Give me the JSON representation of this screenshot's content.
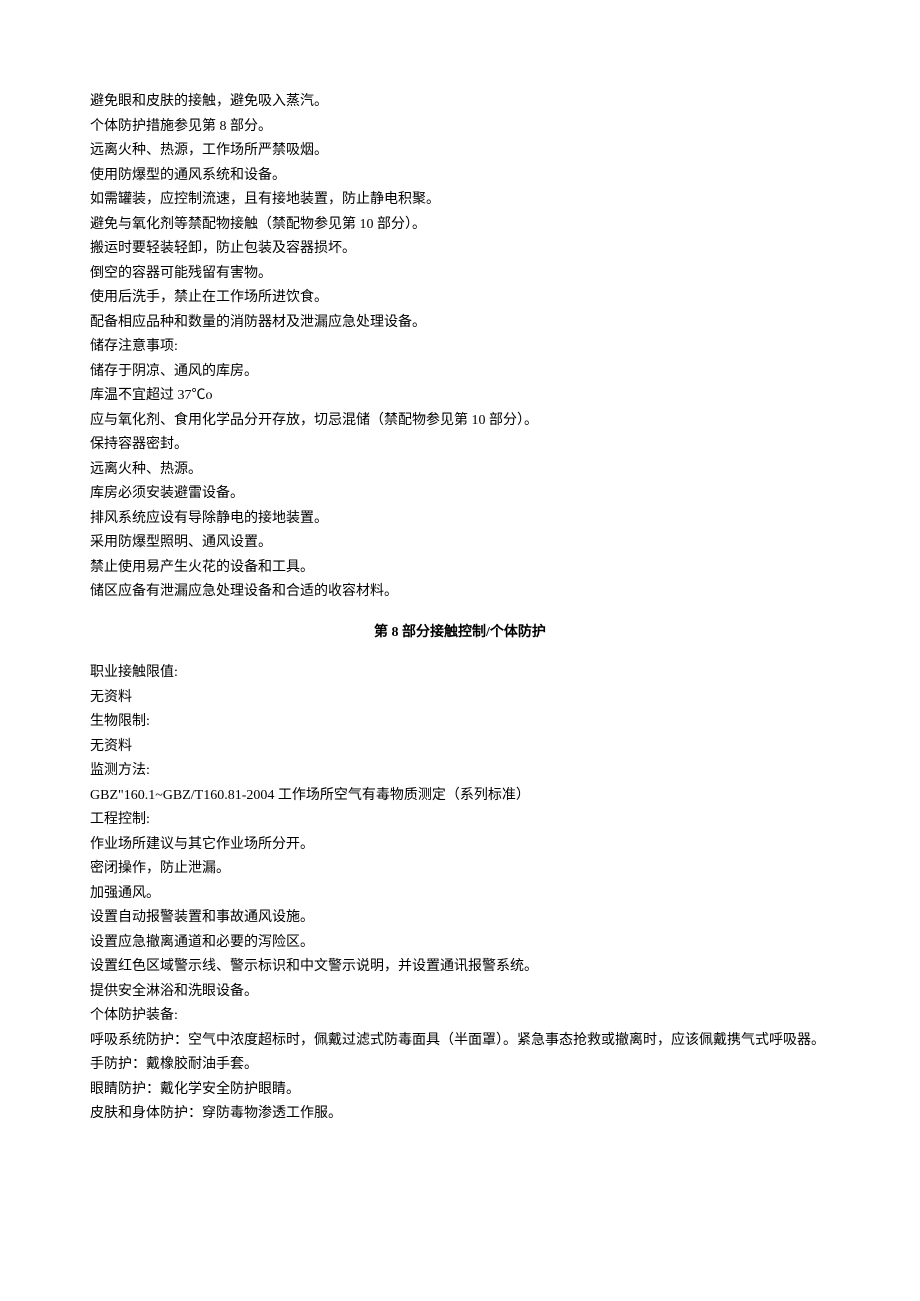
{
  "section7": {
    "handling_lines": [
      "避免眼和皮肤的接触，避免吸入蒸汽。",
      "个体防护措施参见第 8 部分。",
      "远离火种、热源，工作场所严禁吸烟。",
      "使用防爆型的通风系统和设备。",
      "如需罐装，应控制流速，且有接地装置，防止静电积聚。",
      "避免与氧化剂等禁配物接触（禁配物参见第 10 部分）。",
      "搬运时要轻装轻卸，防止包装及容器损坏。",
      "倒空的容器可能残留有害物。",
      "使用后洗手，禁止在工作场所进饮食。",
      "配备相应品种和数量的消防器材及泄漏应急处理设备。"
    ],
    "storage_heading": "储存注意事项:",
    "storage_lines": [
      "储存于阴凉、通风的库房。",
      "库温不宜超过 37℃o",
      "应与氧化剂、食用化学品分开存放，切忌混储（禁配物参见第 10 部分）。",
      "保持容器密封。",
      "远离火种、热源。",
      "库房必须安装避雷设备。",
      "排风系统应设有导除静电的接地装置。",
      "采用防爆型照明、通风设置。",
      "禁止使用易产生火花的设备和工具。",
      "储区应备有泄漏应急处理设备和合适的收容材料。"
    ]
  },
  "section8": {
    "title_prefix": "第 ",
    "title_num": "8",
    "title_suffix": " 部分接触控制/个体防护",
    "exposure_limit_heading": "职业接触限值:",
    "exposure_limit_value": "无资料",
    "bio_limit_heading": "生物限制:",
    "bio_limit_value": "无资料",
    "monitoring_heading": "监测方法:",
    "monitoring_value": "GBZ\"160.1~GBZ/T160.81-2004 工作场所空气有毒物质测定（系列标准）",
    "engineering_heading": "工程控制:",
    "engineering_lines": [
      "作业场所建议与其它作业场所分开。",
      "密闭操作，防止泄漏。",
      "加强通风。",
      "设置自动报警装置和事故通风设施。",
      "设置应急撤离通道和必要的泻险区。",
      "设置红色区域警示线、警示标识和中文警示说明，并设置通讯报警系统。",
      "提供安全淋浴和洗眼设备。"
    ],
    "ppe_heading": "个体防护装备:",
    "ppe_respiratory": "呼吸系统防护：空气中浓度超标时，佩戴过滤式防毒面具（半面罩）。紧急事态抢救或撤离时，应该佩戴携气式呼吸器。",
    "ppe_hands": "手防护：戴橡胶耐油手套。",
    "ppe_eyes": "眼睛防护：戴化学安全防护眼睛。",
    "ppe_skin": "皮肤和身体防护：穿防毒物渗透工作服。"
  }
}
